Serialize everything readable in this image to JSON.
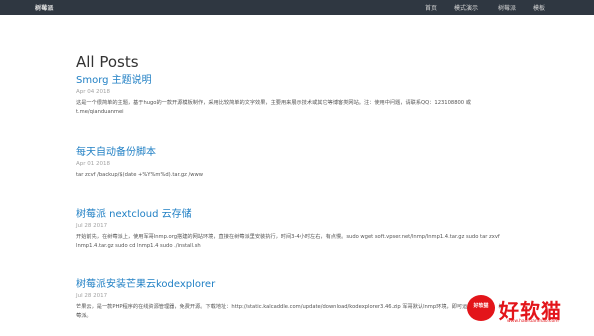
{
  "header": {
    "brand": "树莓派",
    "nav": [
      "首页",
      "模式演示",
      "树莓派",
      "模板"
    ]
  },
  "main": {
    "title": "All Posts",
    "posts": [
      {
        "title": "Smorg 主题说明",
        "date": "Apr 04 2018",
        "excerpt": "这是一个很简单的主题，基于hugo的一款开源模板制作，采用比较简单的文字效果，主要用来展示技术或其它等博客类网站。注：使用中问题，请联系QQ：123108800 或 t.me/qianduanmei"
      },
      {
        "title": "每天自动备份脚本",
        "date": "Apr 01 2018",
        "excerpt": "tar zcvf /backup/$(date +%Y%m%d).tar.gz /www"
      },
      {
        "title": "树莓派 nextcloud 云存储",
        "date": "Jul 28 2017",
        "excerpt": "开始前先，在树莓派上，使用军哥lnmp.org搭建的网站环境，直接在树莓派里安装执行，时间3-4小时左右，有点慢。sudo wget soft.vpser.net/lnmp/lnmp1.4.tar.gz sudo tar zxvf lnmp1.4.tar.gz sudo cd lnmp1.4 sudo ./install.sh"
      },
      {
        "title": "树莓派安装芒果云kodexplorer",
        "date": "Jul 28 2017",
        "excerpt": "芒果云，是一款PHP程序的在线资源管理器，免费开源。下载地址：http://static.kalcaddle.com/update/download/kodexplorer3.46.zip 军哥默认lnmp环境，即可运行。页面了，树莓派。"
      }
    ]
  },
  "watermark": {
    "badge": "好软猫",
    "name": "好软猫",
    "url": "www.haoruanmao.com"
  }
}
